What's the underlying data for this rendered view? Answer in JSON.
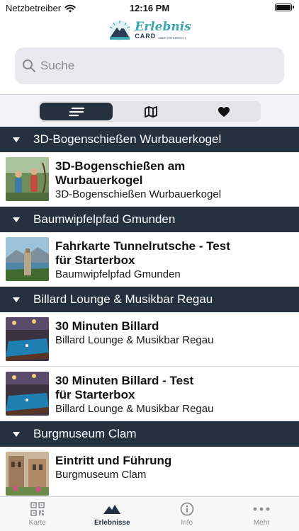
{
  "status_bar": {
    "carrier": "Netzbetreiber",
    "time": "12:16 PM"
  },
  "logo": {
    "script_text": "Erlebnis",
    "sub_text": "CARD",
    "tiny_text": "OBER ÖSTERREICH"
  },
  "search": {
    "placeholder": "Suche",
    "value": ""
  },
  "segments": [
    {
      "icon": "list-icon",
      "active": true
    },
    {
      "icon": "map-icon",
      "active": false
    },
    {
      "icon": "heart-icon",
      "active": false
    }
  ],
  "sections": [
    {
      "header": "3D-Bogenschießen Wurbauerkogel",
      "items": [
        {
          "title_line1": "3D-Bogenschießen am",
          "title_line2": "Wurbauerkogel",
          "subtitle": "3D-Bogenschießen Wurbauerkogel"
        }
      ]
    },
    {
      "header": "Baumwipfelpfad Gmunden",
      "items": [
        {
          "title_line1": "Fahrkarte Tunnelrutsche - Test",
          "title_line2": "für Starterbox",
          "subtitle": "Baumwipfelpfad Gmunden"
        }
      ]
    },
    {
      "header": "Billard Lounge & Musikbar Regau",
      "items": [
        {
          "title_line1": "30 Minuten Billard",
          "title_line2": "",
          "subtitle": "Billard Lounge & Musikbar Regau"
        },
        {
          "title_line1": "30 Minuten Billard - Test",
          "title_line2": "für Starterbox",
          "subtitle": "Billard Lounge & Musikbar Regau"
        }
      ]
    },
    {
      "header": "Burgmuseum Clam",
      "items": [
        {
          "title_line1": "Eintritt und Führung",
          "title_line2": "",
          "subtitle": "Burgmuseum Clam"
        }
      ]
    }
  ],
  "tabs": [
    {
      "label": "Karte",
      "icon": "qr-code-icon",
      "active": false
    },
    {
      "label": "Erlebnisse",
      "icon": "mountain-icon",
      "active": true
    },
    {
      "label": "Info",
      "icon": "info-icon",
      "active": false
    },
    {
      "label": "Mehr",
      "icon": "more-icon",
      "active": false
    }
  ],
  "colors": {
    "accent": "#263140",
    "search_bg": "#e9e9ee",
    "logo_teal": "#3aa6b0"
  }
}
